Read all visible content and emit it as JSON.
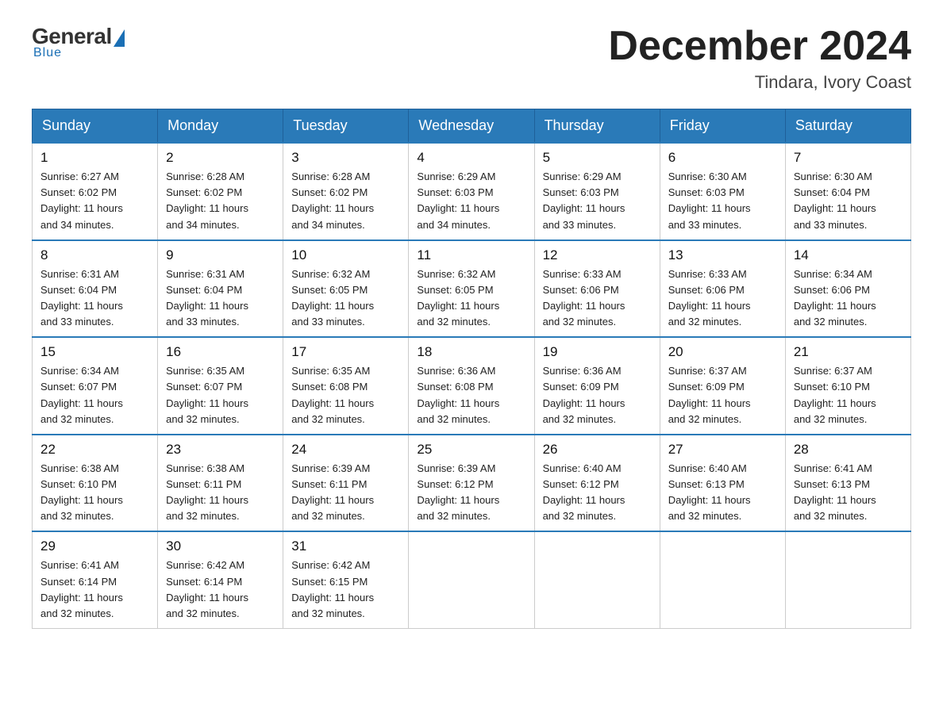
{
  "logo": {
    "general": "General",
    "blue": "Blue",
    "bottom": "Blue"
  },
  "header": {
    "month_title": "December 2024",
    "location": "Tindara, Ivory Coast"
  },
  "days_of_week": [
    "Sunday",
    "Monday",
    "Tuesday",
    "Wednesday",
    "Thursday",
    "Friday",
    "Saturday"
  ],
  "weeks": [
    [
      {
        "day": "1",
        "sunrise": "6:27 AM",
        "sunset": "6:02 PM",
        "daylight": "11 hours and 34 minutes."
      },
      {
        "day": "2",
        "sunrise": "6:28 AM",
        "sunset": "6:02 PM",
        "daylight": "11 hours and 34 minutes."
      },
      {
        "day": "3",
        "sunrise": "6:28 AM",
        "sunset": "6:02 PM",
        "daylight": "11 hours and 34 minutes."
      },
      {
        "day": "4",
        "sunrise": "6:29 AM",
        "sunset": "6:03 PM",
        "daylight": "11 hours and 34 minutes."
      },
      {
        "day": "5",
        "sunrise": "6:29 AM",
        "sunset": "6:03 PM",
        "daylight": "11 hours and 33 minutes."
      },
      {
        "day": "6",
        "sunrise": "6:30 AM",
        "sunset": "6:03 PM",
        "daylight": "11 hours and 33 minutes."
      },
      {
        "day": "7",
        "sunrise": "6:30 AM",
        "sunset": "6:04 PM",
        "daylight": "11 hours and 33 minutes."
      }
    ],
    [
      {
        "day": "8",
        "sunrise": "6:31 AM",
        "sunset": "6:04 PM",
        "daylight": "11 hours and 33 minutes."
      },
      {
        "day": "9",
        "sunrise": "6:31 AM",
        "sunset": "6:04 PM",
        "daylight": "11 hours and 33 minutes."
      },
      {
        "day": "10",
        "sunrise": "6:32 AM",
        "sunset": "6:05 PM",
        "daylight": "11 hours and 33 minutes."
      },
      {
        "day": "11",
        "sunrise": "6:32 AM",
        "sunset": "6:05 PM",
        "daylight": "11 hours and 32 minutes."
      },
      {
        "day": "12",
        "sunrise": "6:33 AM",
        "sunset": "6:06 PM",
        "daylight": "11 hours and 32 minutes."
      },
      {
        "day": "13",
        "sunrise": "6:33 AM",
        "sunset": "6:06 PM",
        "daylight": "11 hours and 32 minutes."
      },
      {
        "day": "14",
        "sunrise": "6:34 AM",
        "sunset": "6:06 PM",
        "daylight": "11 hours and 32 minutes."
      }
    ],
    [
      {
        "day": "15",
        "sunrise": "6:34 AM",
        "sunset": "6:07 PM",
        "daylight": "11 hours and 32 minutes."
      },
      {
        "day": "16",
        "sunrise": "6:35 AM",
        "sunset": "6:07 PM",
        "daylight": "11 hours and 32 minutes."
      },
      {
        "day": "17",
        "sunrise": "6:35 AM",
        "sunset": "6:08 PM",
        "daylight": "11 hours and 32 minutes."
      },
      {
        "day": "18",
        "sunrise": "6:36 AM",
        "sunset": "6:08 PM",
        "daylight": "11 hours and 32 minutes."
      },
      {
        "day": "19",
        "sunrise": "6:36 AM",
        "sunset": "6:09 PM",
        "daylight": "11 hours and 32 minutes."
      },
      {
        "day": "20",
        "sunrise": "6:37 AM",
        "sunset": "6:09 PM",
        "daylight": "11 hours and 32 minutes."
      },
      {
        "day": "21",
        "sunrise": "6:37 AM",
        "sunset": "6:10 PM",
        "daylight": "11 hours and 32 minutes."
      }
    ],
    [
      {
        "day": "22",
        "sunrise": "6:38 AM",
        "sunset": "6:10 PM",
        "daylight": "11 hours and 32 minutes."
      },
      {
        "day": "23",
        "sunrise": "6:38 AM",
        "sunset": "6:11 PM",
        "daylight": "11 hours and 32 minutes."
      },
      {
        "day": "24",
        "sunrise": "6:39 AM",
        "sunset": "6:11 PM",
        "daylight": "11 hours and 32 minutes."
      },
      {
        "day": "25",
        "sunrise": "6:39 AM",
        "sunset": "6:12 PM",
        "daylight": "11 hours and 32 minutes."
      },
      {
        "day": "26",
        "sunrise": "6:40 AM",
        "sunset": "6:12 PM",
        "daylight": "11 hours and 32 minutes."
      },
      {
        "day": "27",
        "sunrise": "6:40 AM",
        "sunset": "6:13 PM",
        "daylight": "11 hours and 32 minutes."
      },
      {
        "day": "28",
        "sunrise": "6:41 AM",
        "sunset": "6:13 PM",
        "daylight": "11 hours and 32 minutes."
      }
    ],
    [
      {
        "day": "29",
        "sunrise": "6:41 AM",
        "sunset": "6:14 PM",
        "daylight": "11 hours and 32 minutes."
      },
      {
        "day": "30",
        "sunrise": "6:42 AM",
        "sunset": "6:14 PM",
        "daylight": "11 hours and 32 minutes."
      },
      {
        "day": "31",
        "sunrise": "6:42 AM",
        "sunset": "6:15 PM",
        "daylight": "11 hours and 32 minutes."
      },
      null,
      null,
      null,
      null
    ]
  ],
  "labels": {
    "sunrise_prefix": "Sunrise: ",
    "sunset_prefix": "Sunset: ",
    "daylight_prefix": "Daylight: "
  }
}
